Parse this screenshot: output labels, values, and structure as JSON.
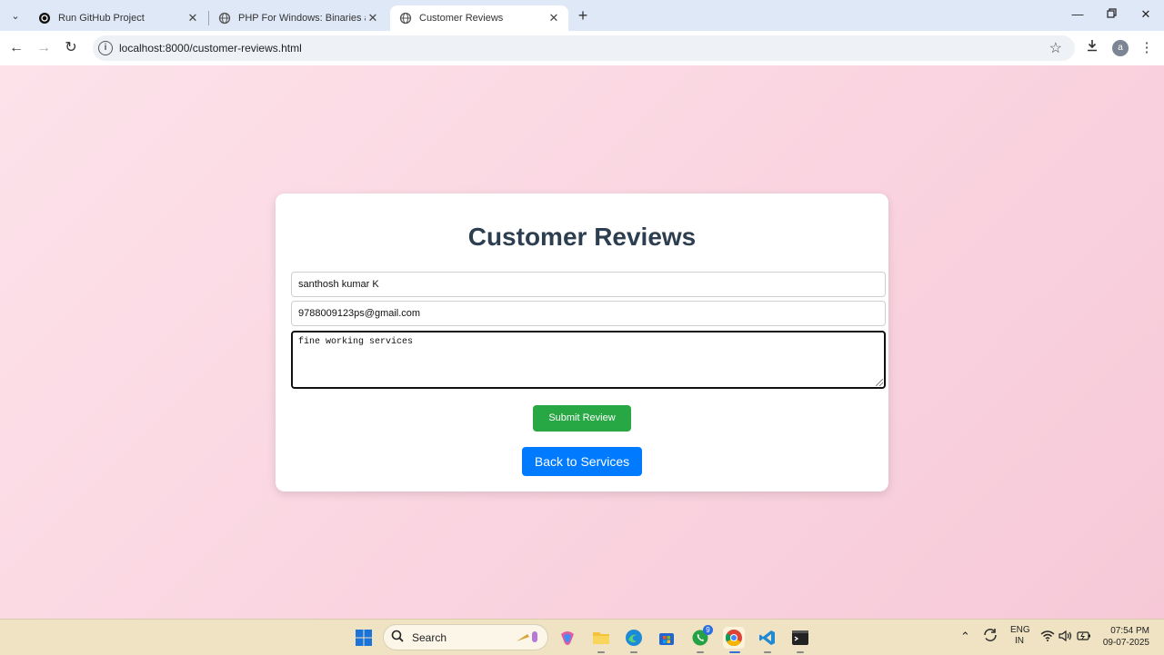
{
  "browser": {
    "tabs": [
      {
        "label": "Run GitHub Project",
        "icon": "openai-icon",
        "active": false
      },
      {
        "label": "PHP For Windows: Binaries and",
        "icon": "globe-icon",
        "active": false
      },
      {
        "label": "Customer Reviews",
        "icon": "globe-icon",
        "active": true
      }
    ],
    "url": "localhost:8000/customer-reviews.html",
    "profile_initial": "a"
  },
  "page": {
    "title": "Customer Reviews",
    "name_value": "santhosh kumar K",
    "email_value": "9788009123ps@gmail.com",
    "review_value": "fine working services",
    "submit_label": "Submit Review",
    "back_label": "Back to Services",
    "colors": {
      "submit": "#28a745",
      "back": "#007bff",
      "title": "#2c3e50"
    }
  },
  "taskbar": {
    "search_label": "Search",
    "whatsapp_badge": "9",
    "lang_top": "ENG",
    "lang_bottom": "IN",
    "time": "07:54 PM",
    "date": "09-07-2025"
  }
}
